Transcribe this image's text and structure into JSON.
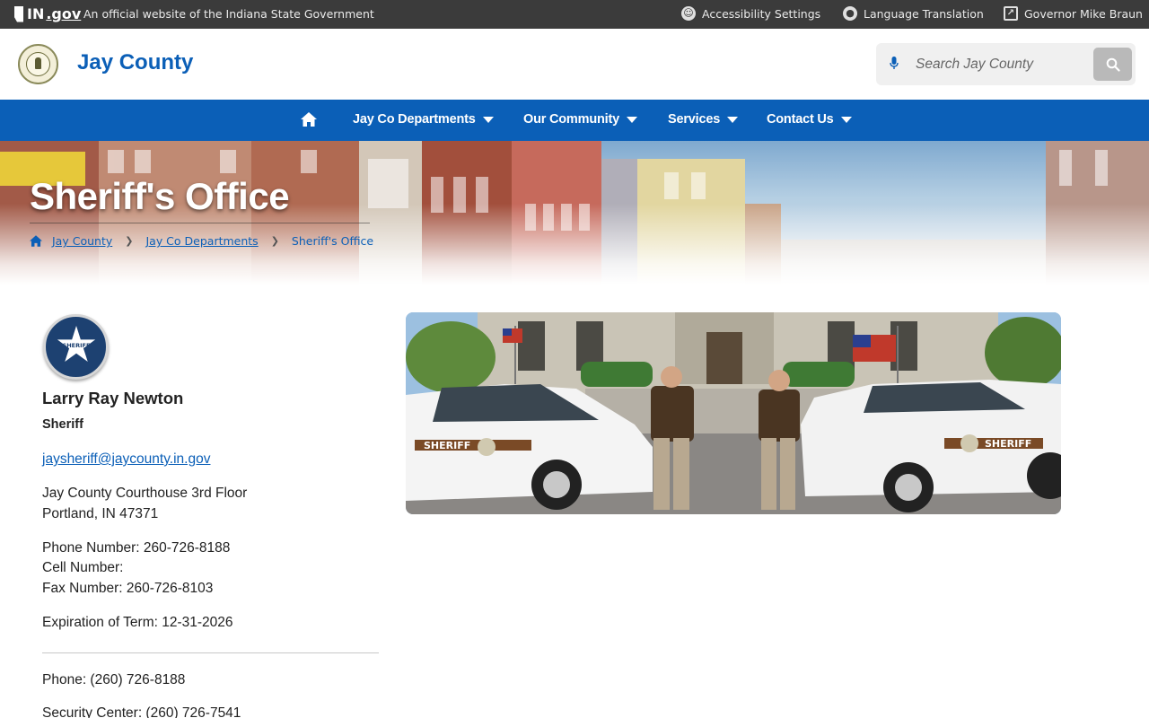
{
  "statebar": {
    "logo_in": "IN",
    "logo_gov": ".gov",
    "official_text": "An official website of the Indiana State Government",
    "links": [
      {
        "label": "Accessibility Settings",
        "icon": "accessibility-icon"
      },
      {
        "label": "Language Translation",
        "icon": "globe-icon"
      },
      {
        "label": "Governor Mike Braun",
        "icon": "external-link-icon"
      }
    ]
  },
  "header": {
    "site_title": "Jay County",
    "search_placeholder": "Search Jay County"
  },
  "nav": {
    "items": [
      {
        "label": "Jay Co Departments"
      },
      {
        "label": "Our Community"
      },
      {
        "label": "Services"
      },
      {
        "label": "Contact Us"
      }
    ]
  },
  "hero": {
    "title": "Sheriff's Office",
    "breadcrumbs": [
      "Jay County",
      "Jay Co Departments",
      "Sheriff's Office"
    ]
  },
  "contact": {
    "badge_text": "SHERIFF",
    "name": "Larry Ray Newton",
    "role": "Sheriff",
    "email": "jaysheriff@jaycounty.in.gov",
    "address_line1": "Jay County Courthouse 3rd Floor",
    "address_line2": "Portland, IN 47371",
    "phone": "Phone Number: 260-726-8188",
    "cell": "Cell Number:",
    "fax": "Fax Number: 260-726-8103",
    "term": "Expiration of Term: 12-31-2026",
    "phone2": "Phone: (260) 726-8188",
    "security_center": "Security Center: (260) 726-7541"
  },
  "photo": {
    "vehicle_left_text": "SHERIFF",
    "vehicle_right_text": "SHERIFF"
  },
  "colors": {
    "brand_blue": "#0b5fb7",
    "state_bar": "#3b3b3b",
    "badge_navy": "#1d4171"
  }
}
